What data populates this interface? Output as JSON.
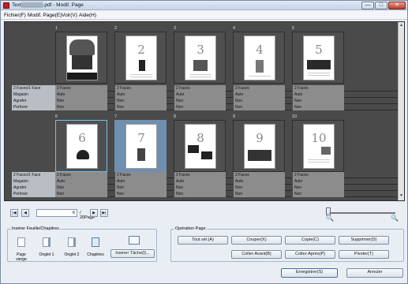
{
  "window": {
    "title": "Text▒▒▒▒▒▒.pdf - Modif. Page",
    "min_glyph": "—",
    "max_glyph": "□",
    "close_glyph": "✕"
  },
  "menu": [
    "Fichier(F)",
    "Modif. Page(E)",
    "Voir(V)",
    "Aide(H)"
  ],
  "props_labels": [
    "2 Faces/1 Face",
    "Magasin",
    "Agrafer",
    "Perforer"
  ],
  "pages": [
    {
      "num": "1",
      "values": [
        "2 Faces",
        "Auto",
        "Non",
        "Non"
      ]
    },
    {
      "num": "2",
      "values": [
        "2 Faces",
        "Auto",
        "Non",
        "Non"
      ]
    },
    {
      "num": "3",
      "values": [
        "2 Faces",
        "Auto",
        "Non",
        "Non"
      ]
    },
    {
      "num": "4",
      "values": [
        "2 Faces",
        "Auto",
        "Non",
        "Non"
      ]
    },
    {
      "num": "5",
      "values": [
        "2 Faces",
        "Auto",
        "Non",
        "Non"
      ]
    },
    {
      "num": "6",
      "values": [
        "2 Faces",
        "Auto",
        "Non",
        "Non"
      ]
    },
    {
      "num": "7",
      "values": [
        "2 Faces",
        "Auto",
        "Non",
        "Non"
      ]
    },
    {
      "num": "8",
      "values": [
        "2 Faces",
        "Auto",
        "Non",
        "Non"
      ]
    },
    {
      "num": "9",
      "values": [
        "2 Faces",
        "Auto",
        "Non",
        "Non"
      ]
    },
    {
      "num": "10",
      "values": [
        "2 Faces",
        "Auto",
        "Non",
        "Non"
      ]
    }
  ],
  "page_digits": [
    "2",
    "3",
    "4",
    "5",
    "6",
    "7",
    "8",
    "9",
    "10"
  ],
  "nav": {
    "current_page": "6",
    "page_count": "/ 20Page",
    "first": "|◀",
    "prev": "◀",
    "next": "▶",
    "last": "▶|"
  },
  "zoom": {
    "out_icon": "zoom-out-icon",
    "in_icon": "zoom-in-icon",
    "out_glyph": "🔍",
    "in_glyph": "🔍",
    "level_fraction": 0.0
  },
  "insert_group": {
    "title": "Insérer Feuille/Chapitres",
    "blank": "Page vierge",
    "tab1": "Onglet 1",
    "tab2": "Onglet 2",
    "chapters": "Chapitres",
    "insert_task": "Insérer Tâche(I)..."
  },
  "operation_group": {
    "title": "Opération Page",
    "select_all": "Tout sél.(A)",
    "cut": "Couper(X)",
    "copy": "Copie(C)",
    "delete": "Supprimer(D)",
    "paste_before": "Coller-Avant(B)",
    "paste_after": "Coller-Après(P)",
    "rotate": "Pivoter(T)"
  },
  "footer": {
    "save": "Enregistrer(S)",
    "cancel": "Annuler"
  },
  "colors": {
    "viewer_bg": "#4a4a4a",
    "selected_outline": "#6ec3f0",
    "selected_fill": "#6f8fb0"
  }
}
